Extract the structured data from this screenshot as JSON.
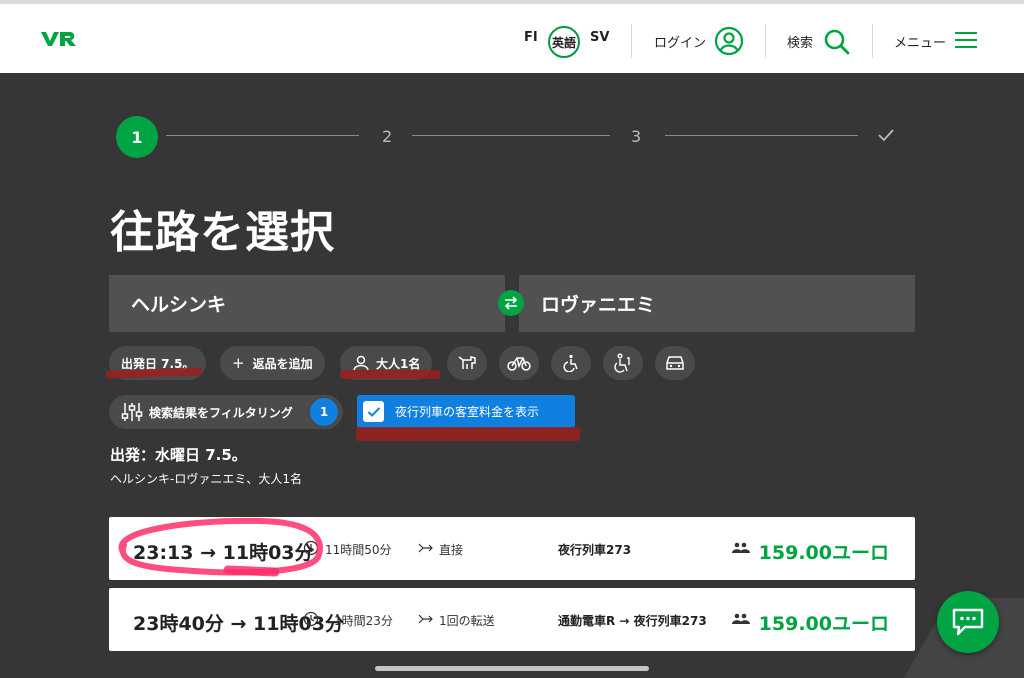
{
  "header": {
    "lang_fi": "FI",
    "lang_active": "英語",
    "lang_sv": "SV",
    "login_label": "ログイン",
    "search_label": "検索",
    "menu_label": "メニュー"
  },
  "stepper": {
    "steps": [
      "1",
      "2",
      "3"
    ],
    "current": "1"
  },
  "page_title": "往路を選択",
  "route": {
    "from": "ヘルシンキ",
    "to": "ロヴァニエミ"
  },
  "chips": {
    "date": "出発日 7.5。",
    "add_return": "返品を追加",
    "passengers": "大人1名",
    "filter": "検索結果をフィルタリング",
    "filter_count": "1",
    "night_toggle": "夜行列車の客室料金を表示"
  },
  "departure": {
    "title": "出発：水曜日 7.5。",
    "subtitle": "ヘルシンキ-ロヴァニエミ、大人1名"
  },
  "results": [
    {
      "time": "23:13 → 11時03分",
      "duration": "11時間50分",
      "connection": "直接",
      "train": "夜行列車273",
      "price": "159.00ユーロ"
    },
    {
      "time": "23時40分 → 11時03分",
      "duration": "1時間23分",
      "connection": "1回の転送",
      "train": "通勤電車R → 夜行列車273",
      "price": "159.00ユーロ"
    }
  ],
  "colors": {
    "brand_green": "#00a443",
    "background": "#363636",
    "accent_blue": "#0f7fe0",
    "annotation_red": "#9c1f1f",
    "annotation_pink": "#ff2d6b"
  }
}
